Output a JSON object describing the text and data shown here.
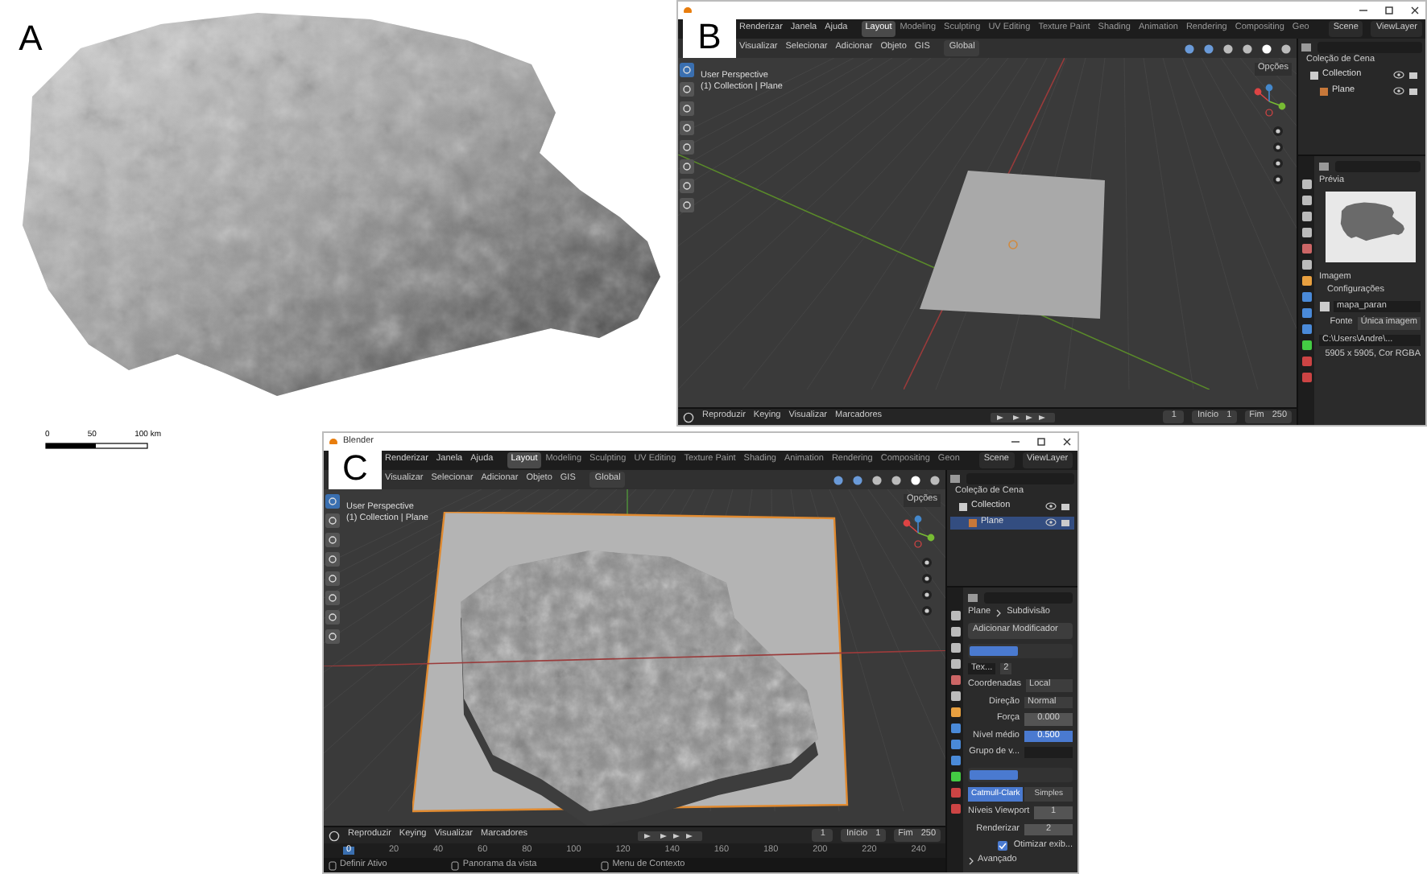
{
  "panel_a": {
    "label": "A",
    "scale_bar": [
      "0",
      "50",
      "100 km"
    ]
  },
  "panel_b": {
    "label": "B",
    "menus": [
      "Renderizar",
      "Janela",
      "Ajuda"
    ],
    "workspaces": [
      {
        "label": "Layout",
        "selected": true
      },
      {
        "label": "Modeling",
        "selected": false
      },
      {
        "label": "Sculpting",
        "selected": false
      },
      {
        "label": "UV Editing",
        "selected": false
      },
      {
        "label": "Texture Paint",
        "selected": false
      },
      {
        "label": "Shading",
        "selected": false
      },
      {
        "label": "Animation",
        "selected": false
      },
      {
        "label": "Rendering",
        "selected": false
      },
      {
        "label": "Compositing",
        "selected": false
      },
      {
        "label": "Geo",
        "selected": false
      }
    ],
    "scene": "Scene",
    "view_layer": "ViewLayer",
    "header_menus": [
      "Visualizar",
      "Selecionar",
      "Adicionar",
      "Objeto",
      "GIS"
    ],
    "transform": "Global",
    "options": "Opções",
    "viewport": {
      "kind": "plane",
      "info": [
        "User Perspective",
        "(1) Collection | Plane"
      ]
    },
    "outliner": {
      "title": "Coleção de Cena",
      "items": [
        {
          "label": "Collection",
          "selected": false,
          "children": [
            {
              "label": "Plane",
              "selected": false
            }
          ]
        }
      ]
    },
    "properties": {
      "kind": "texture",
      "preview_title": "Prévia",
      "image_section": "Imagem",
      "settings_section": "Configurações",
      "image_name": "mapa_paran",
      "source_label": "Fonte",
      "source_value": "Única imagem",
      "path": "C:\\Users\\Andre\\...",
      "info": "5905 x 5905, Cor RGBA"
    },
    "timeline": {
      "menus": [
        "Reproduzir",
        "Keying",
        "Visualizar",
        "Marcadores"
      ],
      "frame": "1",
      "start_label": "Início",
      "start": "1",
      "end_label": "Fim",
      "end": "250"
    }
  },
  "panel_c": {
    "label": "C",
    "title": "Blender",
    "menus": [
      "Renderizar",
      "Janela",
      "Ajuda"
    ],
    "workspaces": [
      {
        "label": "Layout",
        "selected": true
      },
      {
        "label": "Modeling",
        "selected": false
      },
      {
        "label": "Sculpting",
        "selected": false
      },
      {
        "label": "UV Editing",
        "selected": false
      },
      {
        "label": "Texture Paint",
        "selected": false
      },
      {
        "label": "Shading",
        "selected": false
      },
      {
        "label": "Animation",
        "selected": false
      },
      {
        "label": "Rendering",
        "selected": false
      },
      {
        "label": "Compositing",
        "selected": false
      },
      {
        "label": "Geon",
        "selected": false
      }
    ],
    "scene": "Scene",
    "view_layer": "ViewLayer",
    "header_menus": [
      "Visualizar",
      "Selecionar",
      "Adicionar",
      "Objeto",
      "GIS"
    ],
    "transform": "Global",
    "options": "Opções",
    "viewport": {
      "kind": "terrain",
      "info": [
        "User Perspective",
        "(1) Collection | Plane"
      ]
    },
    "outliner": {
      "title": "Coleção de Cena",
      "items": [
        {
          "label": "Collection",
          "selected": false,
          "children": [
            {
              "label": "Plane",
              "selected": true
            }
          ]
        }
      ]
    },
    "properties": {
      "kind": "modifiers",
      "breadcrumb": [
        "Plane",
        "Subdivisão"
      ],
      "add_modifier": "Adicionar Modificador",
      "texture_field": "Tex...",
      "texture_users": "2",
      "rows": [
        {
          "kind": "dropdown",
          "label": "Coordenadas",
          "value": "Local"
        },
        {
          "kind": "dropdown",
          "label": "Direção",
          "value": "Normal"
        },
        {
          "kind": "number",
          "label": "Força",
          "value": "0.000",
          "selected": false
        },
        {
          "kind": "number",
          "label": "Nível médio",
          "value": "0.500",
          "selected": true
        },
        {
          "kind": "group",
          "label": "Grupo de v..."
        },
        {
          "kind": "modifier_header"
        },
        {
          "kind": "tabs",
          "tabs": [
            {
              "label": "Catmull-Clark",
              "selected": true
            },
            {
              "label": "Simples",
              "selected": false
            }
          ]
        },
        {
          "kind": "number",
          "label": "Níveis Viewport",
          "value": "1",
          "selected": false
        },
        {
          "kind": "number",
          "label": "Renderizar",
          "value": "2",
          "selected": false
        },
        {
          "kind": "checkbox",
          "label": "Otimizar exib...",
          "checked": true
        },
        {
          "kind": "collapsed",
          "label": "Avançado"
        }
      ]
    },
    "timeline": {
      "menus": [
        "Reproduzir",
        "Keying",
        "Visualizar",
        "Marcadores"
      ],
      "frame": "1",
      "start_label": "Início",
      "start": "1",
      "end_label": "Fim",
      "end": "250"
    },
    "ruler": [
      "0",
      "20",
      "40",
      "60",
      "80",
      "100",
      "120",
      "140",
      "160",
      "180",
      "200",
      "220",
      "240"
    ],
    "status_bar": [
      "Definir Ativo",
      "Panorama da vista",
      "Menu de Contexto"
    ]
  }
}
